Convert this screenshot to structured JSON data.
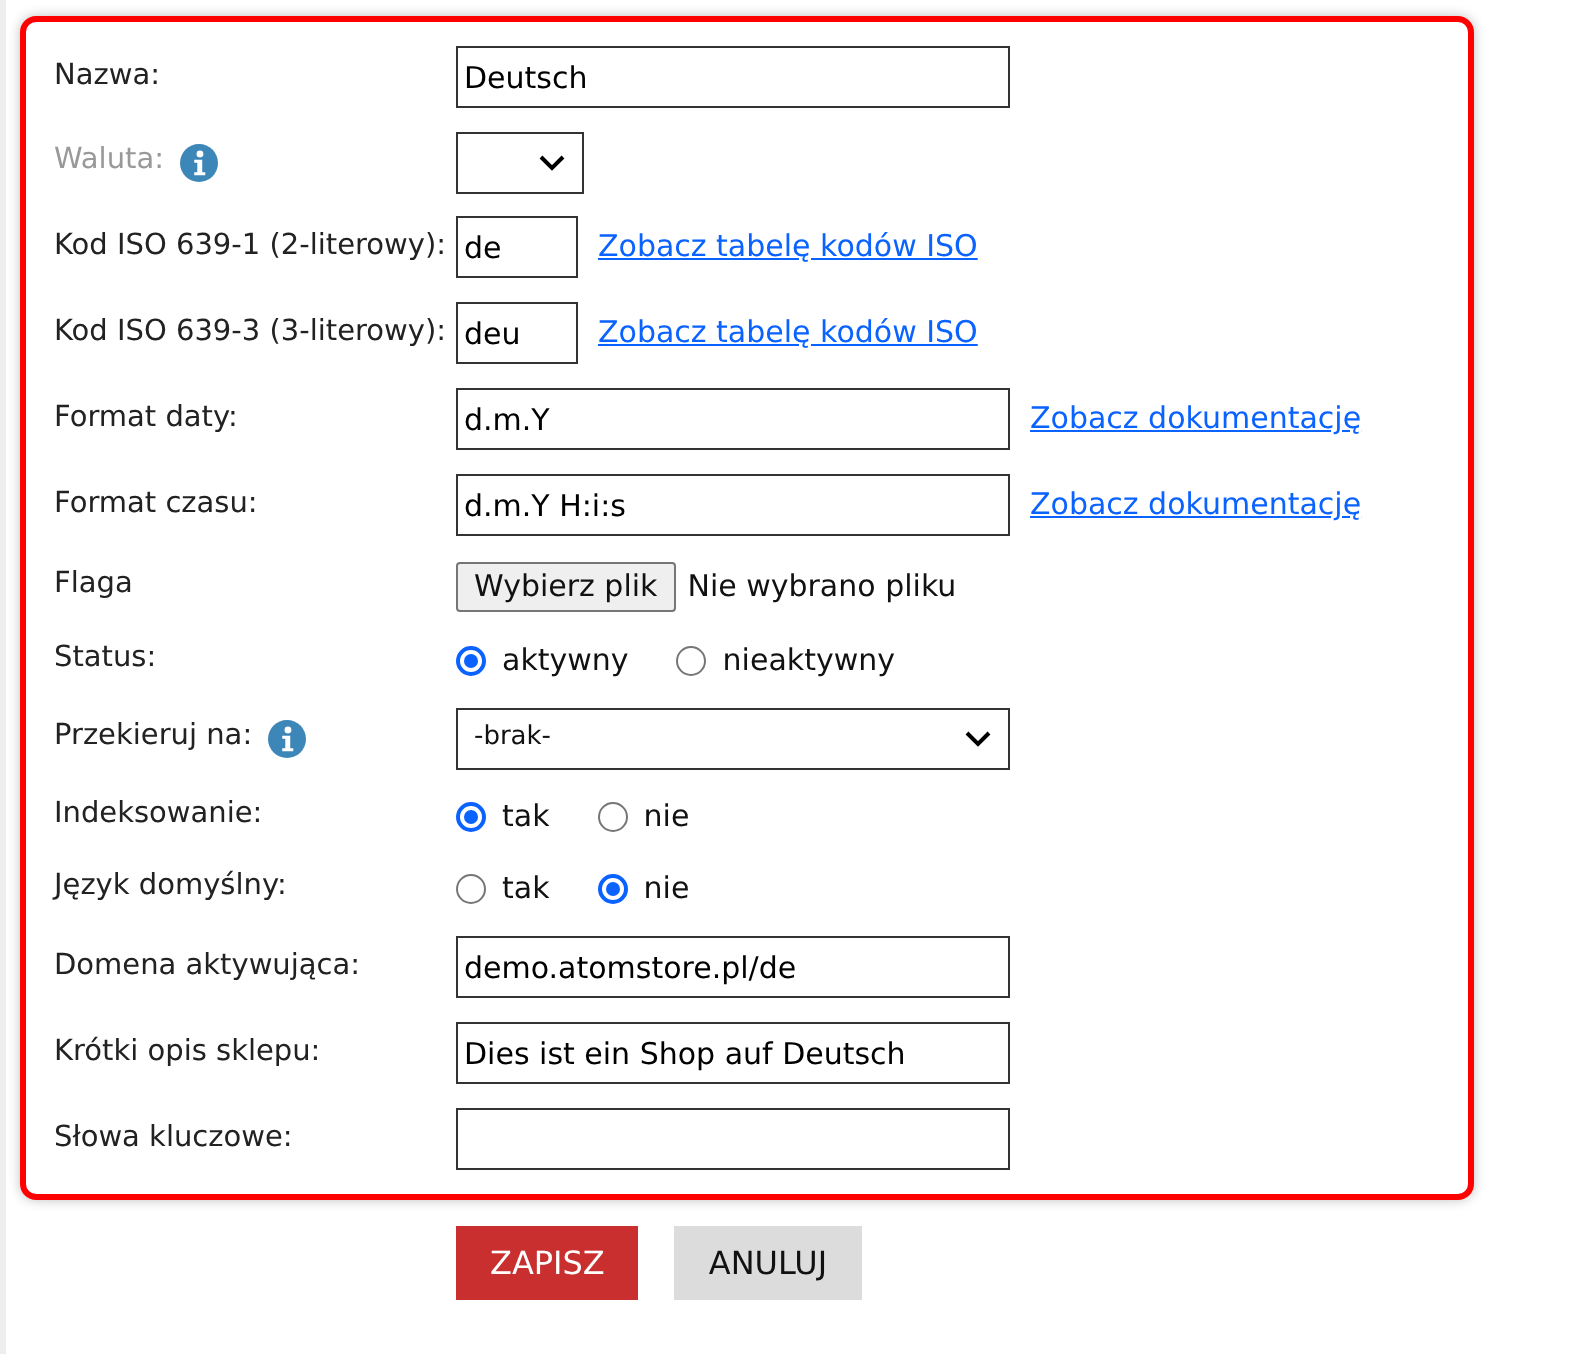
{
  "fields": [
    {
      "kind": "text",
      "label": "Nazwa:",
      "value": "Deutsch"
    },
    {
      "kind": "short-select",
      "label": "Waluta:",
      "disabled": true,
      "info": true
    },
    {
      "kind": "short-text",
      "label": "Kod ISO 639-1 (2-literowy):",
      "value": "de",
      "link": "Zobacz tabelę kodów ISO"
    },
    {
      "kind": "short-text",
      "label": "Kod ISO 639-3 (3-literowy):",
      "value": "deu",
      "link": "Zobacz tabelę kodów ISO"
    },
    {
      "kind": "text",
      "label": "Format daty:",
      "value": "d.m.Y",
      "link": "Zobacz dokumentację"
    },
    {
      "kind": "text",
      "label": "Format czasu:",
      "value": "d.m.Y H:i:s",
      "link": "Zobacz dokumentację"
    },
    {
      "kind": "file",
      "label": "Flaga",
      "button": "Wybierz plik",
      "status": "Nie wybrano pliku"
    },
    {
      "kind": "radio",
      "label": "Status:",
      "options": [
        {
          "label": "aktywny",
          "selected": true
        },
        {
          "label": "nieaktywny",
          "selected": false
        }
      ]
    },
    {
      "kind": "select",
      "label": "Przekieruj na:",
      "info": true,
      "value": "-brak-"
    },
    {
      "kind": "radio",
      "label": "Indeksowanie:",
      "options": [
        {
          "label": "tak",
          "selected": true
        },
        {
          "label": "nie",
          "selected": false
        }
      ]
    },
    {
      "kind": "radio",
      "label": "Język domyślny:",
      "options": [
        {
          "label": "tak",
          "selected": false
        },
        {
          "label": "nie",
          "selected": true
        }
      ]
    },
    {
      "kind": "text",
      "label": "Domena aktywująca:",
      "value": "demo.atomstore.pl/de"
    },
    {
      "kind": "text",
      "label": "Krótki opis sklepu:",
      "value": "Dies ist ein Shop auf Deutsch"
    },
    {
      "kind": "text",
      "label": "Słowa kluczowe:"
    }
  ],
  "buttons": [
    {
      "label": "ZAPISZ",
      "kind": "primary"
    },
    {
      "label": "ANULUJ",
      "kind": "secondary"
    }
  ]
}
